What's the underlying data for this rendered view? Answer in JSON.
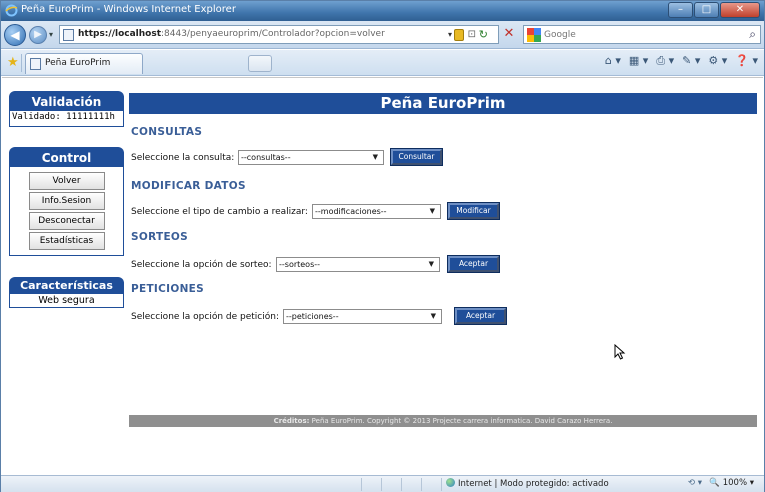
{
  "window": {
    "title": "Peña EuroPrim - Windows Internet Explorer"
  },
  "address_bar": {
    "url_prefix": "https://",
    "url_host": "localhost",
    "url_rest": ":8443/penyaeuroprim/Controlador?opcion=volver"
  },
  "search_box": {
    "placeholder": "Google"
  },
  "tab": {
    "label": "Peña EuroPrim"
  },
  "sidebar": {
    "validation": {
      "heading": "Validación",
      "value": "Validado: 11111111h"
    },
    "control": {
      "heading": "Control",
      "buttons": [
        "Volver",
        "Info.Sesion",
        "Desconectar",
        "Estadísticas"
      ]
    },
    "features": {
      "heading": "Características",
      "value": "Web segura"
    }
  },
  "page": {
    "header": "Peña EuroPrim",
    "sections": [
      {
        "title": "CONSULTAS",
        "label": "Seleccione la consulta:",
        "select": "--consultas--",
        "button": "Consultar"
      },
      {
        "title": "MODIFICAR DATOS",
        "label": "Seleccione el tipo de cambio a realizar:",
        "select": "--modificaciones--",
        "button": "Modificar"
      },
      {
        "title": "SORTEOS",
        "label": "Seleccione la opción de sorteo:",
        "select": "--sorteos--",
        "button": "Aceptar"
      },
      {
        "title": "PETICIONES",
        "label": "Seleccione la opción de petición:",
        "select": "--peticiones--",
        "button": "Aceptar"
      }
    ],
    "footer": {
      "credits_label": "Créditos:",
      "credits_text": "Peña EuroPrim. Copyright © 2013 Projecte carrera informatica. David Carazo Herrera."
    }
  },
  "status_bar": {
    "zone": "Internet | Modo protegido: activado",
    "zoom": "100%"
  },
  "colors": {
    "accent": "#1f4e99",
    "section_title": "#3a5e97",
    "footer_bg": "#8f8f8f"
  }
}
